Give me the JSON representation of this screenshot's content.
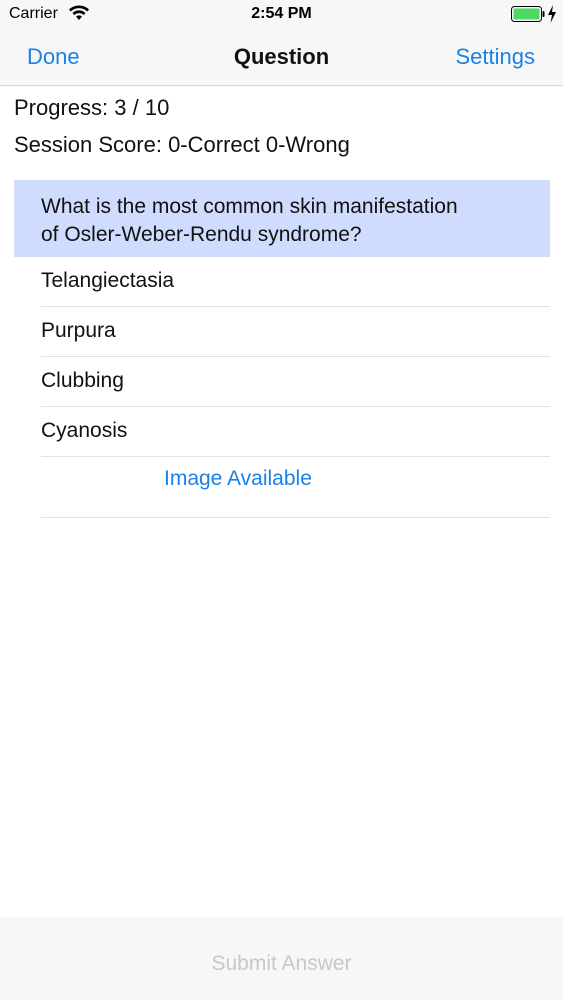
{
  "status_bar": {
    "carrier": "Carrier",
    "time": "2:54 PM",
    "battery_color": "#4cd964"
  },
  "nav": {
    "left_button": "Done",
    "title": "Question",
    "right_button": "Settings",
    "accent_color": "#1a82e6"
  },
  "progress": "Progress: 3 / 10",
  "session_score": "Session Score: 0-Correct 0-Wrong",
  "question": {
    "line1": "What is the most common skin manifestation",
    "line2": "of Osler-Weber-Rendu syndrome?",
    "highlight_color": "#d0dcfd"
  },
  "answers": [
    {
      "label": "Telangiectasia"
    },
    {
      "label": "Purpura"
    },
    {
      "label": "Clubbing"
    },
    {
      "label": "Cyanosis"
    }
  ],
  "image_link": "Image Available",
  "submit_label": "Submit Answer"
}
